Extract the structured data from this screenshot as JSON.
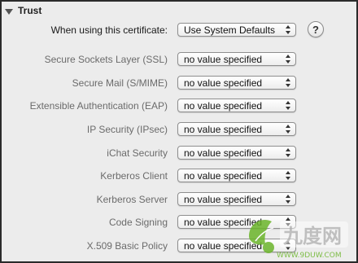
{
  "section": {
    "title": "Trust"
  },
  "main_row": {
    "label": "When using this certificate:",
    "value": "Use System Defaults"
  },
  "help": {
    "glyph": "?"
  },
  "policies": [
    {
      "label": "Secure Sockets Layer (SSL)",
      "value": "no value specified"
    },
    {
      "label": "Secure Mail (S/MIME)",
      "value": "no value specified"
    },
    {
      "label": "Extensible Authentication (EAP)",
      "value": "no value specified"
    },
    {
      "label": "IP Security (IPsec)",
      "value": "no value specified"
    },
    {
      "label": "iChat Security",
      "value": "no value specified"
    },
    {
      "label": "Kerberos Client",
      "value": "no value specified"
    },
    {
      "label": "Kerberos Server",
      "value": "no value specified"
    },
    {
      "label": "Code Signing",
      "value": "no value specified"
    },
    {
      "label": "X.509 Basic Policy",
      "value": "no value specified"
    }
  ],
  "watermark": {
    "logo_text": "九度网",
    "url_text": "WWW.9DUW.COM",
    "colors": {
      "green": "#6bb52b",
      "gray": "#b8b8b8"
    }
  }
}
